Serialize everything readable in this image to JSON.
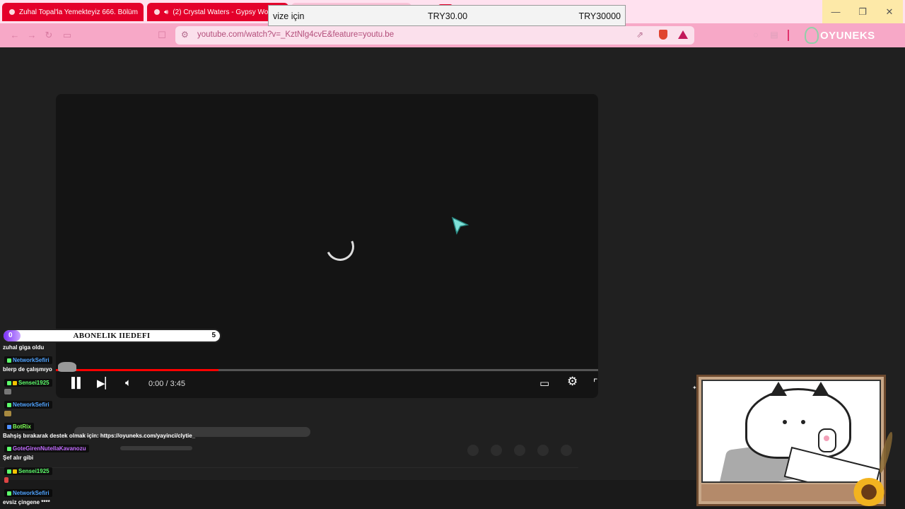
{
  "tabs": [
    {
      "title": "Zuhal Topal'la Yemekteyiz 666. Bölüm"
    },
    {
      "title": "(2) Crystal Waters - Gypsy Wo"
    }
  ],
  "window": {
    "minimize": "—",
    "maximize": "❐",
    "close": "✕"
  },
  "nav": {
    "back": "←",
    "forward": "→",
    "reload": "↻"
  },
  "address": {
    "url": "youtube.com/watch?v=_KztNlg4cvE&feature=youtu.be"
  },
  "brand": {
    "name": "OYUNEKS"
  },
  "donation": {
    "message": "vize için",
    "amount": "TRY30.00",
    "goal": "TRY30000"
  },
  "player": {
    "time": "0:00 / 3:45",
    "progress": 0.3
  },
  "goal": {
    "current": "0",
    "label": "ABONELIK IIEDEFI",
    "target": "5",
    "fraction": 0.08
  },
  "chat": {
    "m0": "zuhal giga oldu",
    "u1": "NetworkSefiri",
    "m1": "blerp de çalışmıyo",
    "u2": "Sensei1925",
    "u3": "NetworkSefiri",
    "u4": "BotRix",
    "m4": "Bahşiş bırakarak destek olmak için: https://oyuneks.com/yayinci/clytie_",
    "u5": "GoteGirenNutellaKavanozu",
    "m5": "Şef alır gibi",
    "u6": "Sensei1925",
    "u7": "NetworkSefiri",
    "m7": "evsiz çingene ****"
  },
  "colors": {
    "accent_pink": "#f7a8c7",
    "tab_red": "#e4002b",
    "goal_purple": "#7b2ff7",
    "user_network": "#4fa3ff",
    "user_sensei": "#5dff6b",
    "user_botrix": "#7dff55",
    "user_gote": "#c36bff"
  }
}
